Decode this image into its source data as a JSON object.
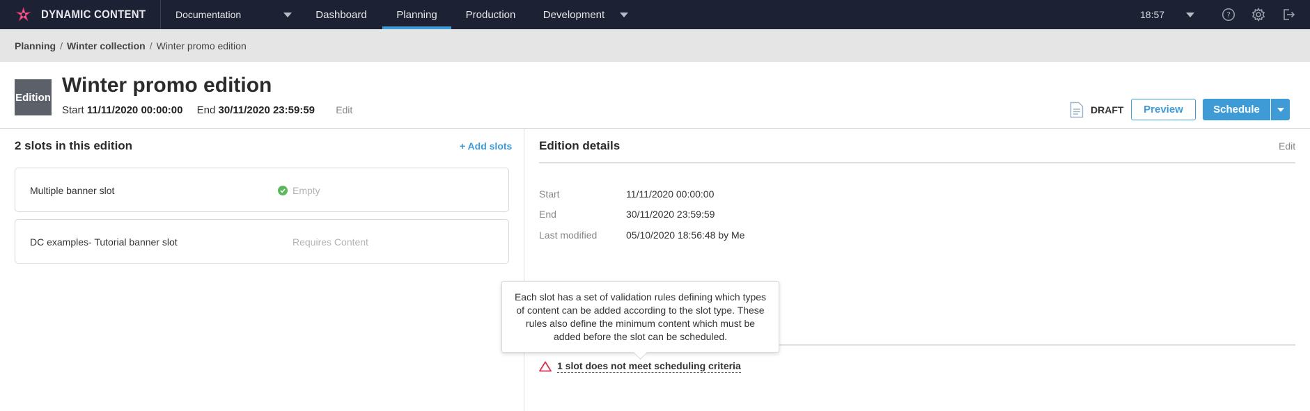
{
  "app": {
    "brand": "DYNAMIC CONTENT",
    "hub": "Documentation",
    "time": "18:57"
  },
  "nav": {
    "tabs": [
      {
        "label": "Dashboard"
      },
      {
        "label": "Planning",
        "active": true
      },
      {
        "label": "Production"
      },
      {
        "label": "Development"
      }
    ]
  },
  "icons": {
    "help": "help-icon",
    "settings": "gear-icon",
    "logout": "logout-icon",
    "logo": "dynamic-content-logo"
  },
  "breadcrumb": [
    "Planning",
    "Winter collection",
    "Winter promo edition"
  ],
  "header": {
    "badge": "Edition",
    "title": "Winter promo edition",
    "start_label": "Start",
    "start_value": "11/11/2020 00:00:00",
    "end_label": "End",
    "end_value": "30/11/2020 23:59:59",
    "edit": "Edit",
    "status": "DRAFT",
    "preview": "Preview",
    "schedule": "Schedule"
  },
  "slots": {
    "title": "2 slots in this edition",
    "add": "+ Add slots",
    "items": [
      {
        "name": "Multiple banner slot",
        "status": "Empty"
      },
      {
        "name": "DC examples- Tutorial banner slot",
        "status": "Requires Content"
      }
    ]
  },
  "details": {
    "title": "Edition details",
    "edit": "Edit",
    "rows": [
      {
        "label": "Start",
        "value": "11/11/2020 00:00:00"
      },
      {
        "label": "End",
        "value": "30/11/2020 23:59:59"
      },
      {
        "label": "Last modified",
        "value": "05/10/2020 18:56:48 by Me"
      }
    ],
    "warning": "1 slot does not meet scheduling criteria"
  },
  "tooltip": {
    "text": "Each slot has a set of validation rules defining which types of content can be added according to the slot type. These rules also define the minimum content which must be added before the slot can be scheduled."
  },
  "colors": {
    "accent": "#3e9bd6",
    "navbar": "#1c2233",
    "warning": "#d9334f",
    "success": "#5cb85c"
  }
}
